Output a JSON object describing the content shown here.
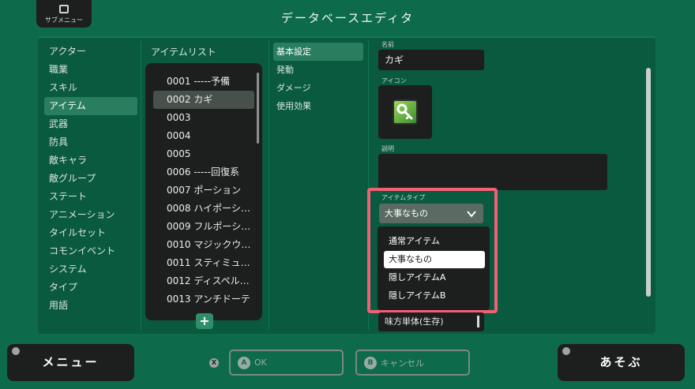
{
  "header": {
    "submenu_label": "サブメニュー",
    "title": "データベースエディタ"
  },
  "categories": [
    {
      "label": "アクター",
      "selected": false
    },
    {
      "label": "職業",
      "selected": false
    },
    {
      "label": "スキル",
      "selected": false
    },
    {
      "label": "アイテム",
      "selected": true
    },
    {
      "label": "武器",
      "selected": false
    },
    {
      "label": "防具",
      "selected": false
    },
    {
      "label": "敵キャラ",
      "selected": false
    },
    {
      "label": "敵グループ",
      "selected": false
    },
    {
      "label": "ステート",
      "selected": false
    },
    {
      "label": "アニメーション",
      "selected": false
    },
    {
      "label": "タイルセット",
      "selected": false
    },
    {
      "label": "コモンイベント",
      "selected": false
    },
    {
      "label": "システム",
      "selected": false
    },
    {
      "label": "タイプ",
      "selected": false
    },
    {
      "label": "用語",
      "selected": false
    }
  ],
  "item_list": {
    "title": "アイテムリスト",
    "add_label": "+",
    "items": [
      {
        "label": "0001 -----予備",
        "selected": false
      },
      {
        "label": "0002 カギ",
        "selected": true
      },
      {
        "label": "0003",
        "selected": false
      },
      {
        "label": "0004",
        "selected": false
      },
      {
        "label": "0005",
        "selected": false
      },
      {
        "label": "0006 -----回復系",
        "selected": false
      },
      {
        "label": "0007 ポーション",
        "selected": false
      },
      {
        "label": "0008 ハイポーシ…",
        "selected": false
      },
      {
        "label": "0009 フルポーシ…",
        "selected": false
      },
      {
        "label": "0010 マジックウ…",
        "selected": false
      },
      {
        "label": "0011 スティミュ…",
        "selected": false
      },
      {
        "label": "0012 ディスペル…",
        "selected": false
      },
      {
        "label": "0013 アンチドーテ",
        "selected": false
      }
    ]
  },
  "settings_tabs": [
    {
      "label": "基本設定",
      "selected": true
    },
    {
      "label": "発動",
      "selected": false
    },
    {
      "label": "ダメージ",
      "selected": false
    },
    {
      "label": "使用効果",
      "selected": false
    }
  ],
  "detail": {
    "name_label": "名前",
    "name_value": "カギ",
    "icon_label": "アイコン",
    "icon_name": "key-icon",
    "description_label": "説明",
    "description_value": "",
    "item_type_label": "アイテムタイプ",
    "item_type_value": "大事なもの",
    "item_type_options": [
      {
        "label": "通常アイテム",
        "selected": false
      },
      {
        "label": "大事なもの",
        "selected": true
      },
      {
        "label": "隠しアイテムA",
        "selected": false
      },
      {
        "label": "隠しアイテムB",
        "selected": false
      }
    ],
    "scope_value": "味方単体(生存)"
  },
  "footer": {
    "menu_label": "メニュー",
    "ok_badge": "A",
    "ok_label": "OK",
    "cancel_badge": "B",
    "cancel_label": "キャンセル",
    "play_label": "あそぶ",
    "x_badge": "X"
  },
  "colors": {
    "background": "#0d6b4c",
    "panel": "#0a5a3f",
    "dark_box": "#1c1f1e",
    "highlight": "#f26075",
    "selected_row": "#2a7e60"
  }
}
